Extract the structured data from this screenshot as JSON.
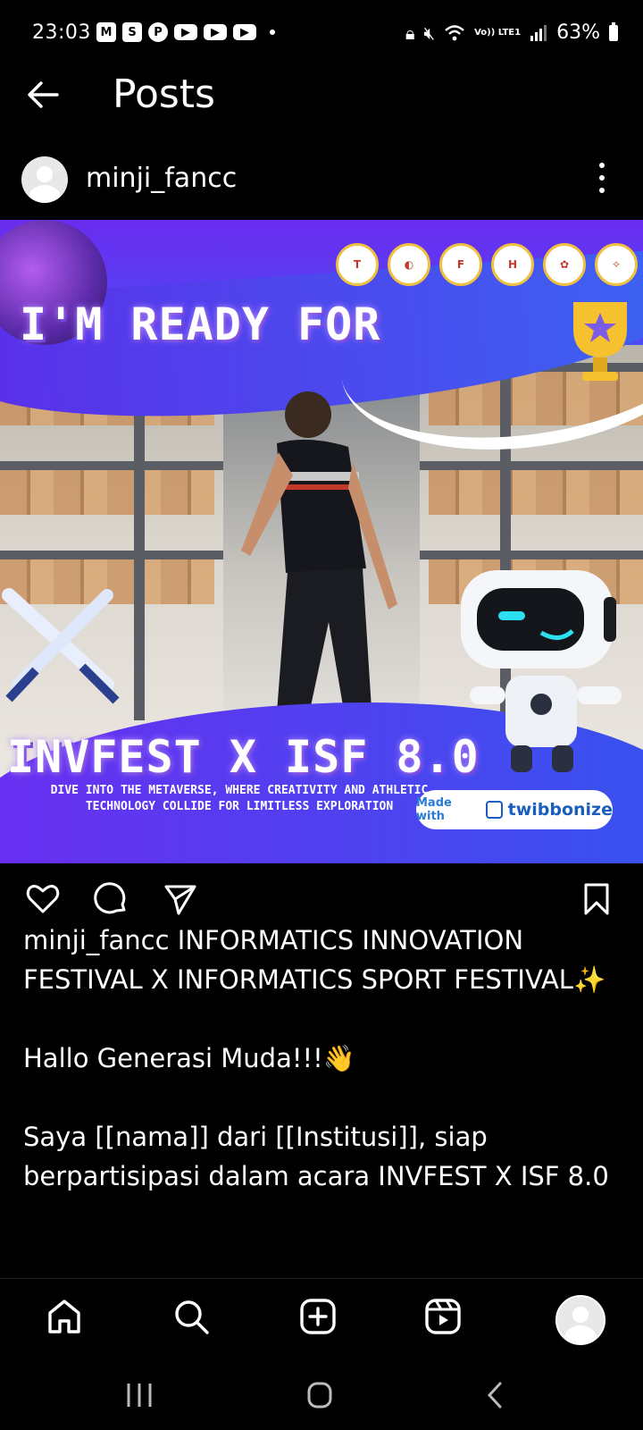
{
  "status_bar": {
    "time": "23:03",
    "battery": "63%",
    "network_label": "Vo)) LTE1",
    "notification_icons": [
      "m-icon",
      "s-icon",
      "pinterest-icon",
      "youtube-icon",
      "youtube-icon",
      "youtube-icon"
    ],
    "system_icons": [
      "lock-icon",
      "mute-icon",
      "wifi-icon",
      "signal-icon",
      "battery-icon"
    ]
  },
  "header": {
    "title": "Posts"
  },
  "post": {
    "username": "minji_fancc",
    "image": {
      "headline": "I'M READY FOR",
      "event": "INVFEST X ISF 8.0",
      "tagline": "DIVE INTO THE METAVERSE, WHERE CREATIVITY AND ATHLETIC TECHNOLOGY COLLIDE FOR LIMITLESS EXPLORATION",
      "badge_prefix": "Made with",
      "badge_brand": "twibbonize"
    },
    "caption": {
      "author": "minji_fancc",
      "line1": "INFORMATICS INNOVATION FESTIVAL X INFORMATICS SPORT FESTIVAL✨",
      "line2": "Hallo Generasi Muda!!!👋",
      "line3": "Saya [[nama]] dari [[Institusi]], siap berpartisipasi dalam acara INVFEST X ISF 8.0"
    }
  },
  "actions": [
    "like-icon",
    "comment-icon",
    "share-icon",
    "save-icon"
  ],
  "bottom_nav": [
    "home-icon",
    "search-icon",
    "create-icon",
    "reels-icon",
    "profile-avatar"
  ],
  "system_nav": [
    "recents-icon",
    "home-circle-icon",
    "back-chevron-icon"
  ],
  "colors": {
    "background": "#000000",
    "text": "#ffffff",
    "image_purple": "#6a2cf0",
    "image_blue": "#3554ef",
    "badge_blue": "#1a5fc0"
  }
}
